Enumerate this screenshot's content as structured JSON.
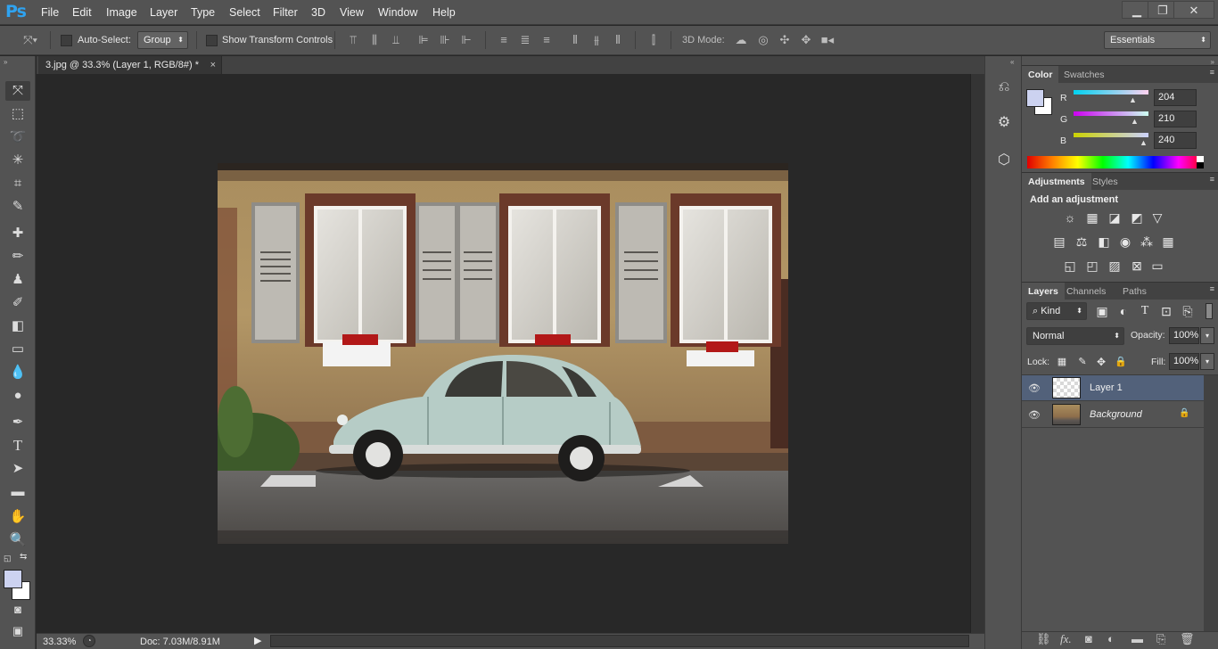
{
  "app": {
    "logo": "Ps"
  },
  "menu": [
    "File",
    "Edit",
    "Image",
    "Layer",
    "Type",
    "Select",
    "Filter",
    "3D",
    "View",
    "Window",
    "Help"
  ],
  "window_controls": {
    "minimize": "▁",
    "restore": "❐",
    "close": "✕"
  },
  "options": {
    "auto_select_label": "Auto-Select:",
    "auto_select_mode": "Group",
    "transform_controls_label": "Show Transform Controls",
    "mode_3d_label": "3D Mode:",
    "workspace": "Essentials"
  },
  "document": {
    "tab_title": "3.jpg @ 33.3% (Layer 1, RGB/8#) *",
    "tab_close": "×"
  },
  "status": {
    "zoom": "33.33%",
    "doc_info": "Doc: 7.03M/8.91M"
  },
  "color_panel": {
    "tabs": [
      "Color",
      "Swatches"
    ],
    "labels": [
      "R",
      "G",
      "B"
    ],
    "values": [
      "204",
      "210",
      "240"
    ],
    "foreground": "#ccd2f0",
    "background": "#ffffff"
  },
  "adjustments_panel": {
    "tabs": [
      "Adjustments",
      "Styles"
    ],
    "heading": "Add an adjustment"
  },
  "layers_panel": {
    "tabs": [
      "Layers",
      "Channels",
      "Paths"
    ],
    "filter_kind": "Kind",
    "blend_mode": "Normal",
    "opacity_label": "Opacity:",
    "opacity_value": "100%",
    "lock_label": "Lock:",
    "fill_label": "Fill:",
    "fill_value": "100%",
    "layers": [
      {
        "name": "Layer 1",
        "selected": true
      },
      {
        "name": "Background",
        "selected": false,
        "locked": true
      }
    ]
  },
  "colors": {
    "ui_dark": "#535353",
    "canvas": "#282828",
    "ps_blue": "#2fa3f0",
    "selected_layer": "#52617a"
  }
}
